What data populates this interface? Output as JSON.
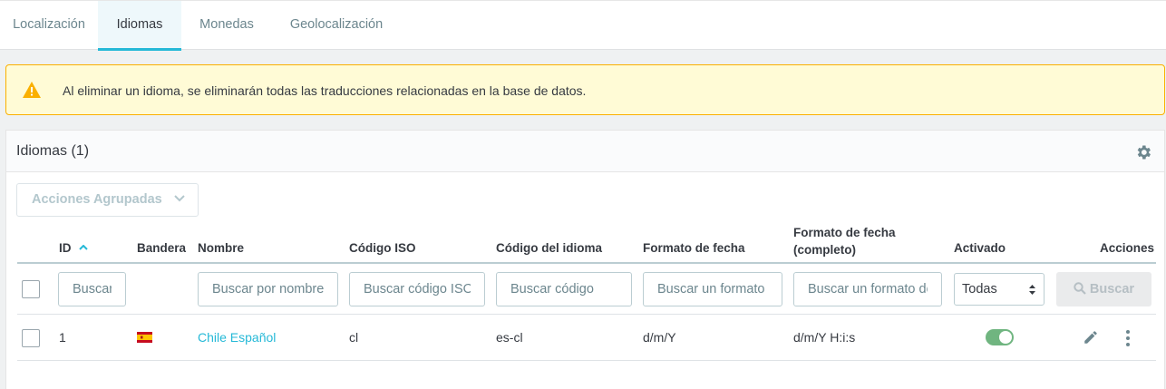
{
  "tabs": [
    {
      "label": "Localización"
    },
    {
      "label": "Idiomas"
    },
    {
      "label": "Monedas"
    },
    {
      "label": "Geolocalización"
    }
  ],
  "alert": {
    "text": "Al eliminar un idioma, se eliminarán todas las traducciones relacionadas en la base de datos."
  },
  "panel": {
    "title": "Idiomas (1)",
    "bulk_actions_label": "Acciones Agrupadas",
    "columns": {
      "id": "ID",
      "flag": "Bandera",
      "name": "Nombre",
      "iso": "Código ISO",
      "lang_code": "Código del idioma",
      "date_format": "Formato de fecha",
      "date_format_full_1": "Formato de fecha",
      "date_format_full_2": "(completo)",
      "active": "Activado",
      "actions": "Acciones"
    },
    "filters": {
      "id_placeholder": "Buscar ID",
      "name_placeholder": "Buscar por nombre",
      "iso_placeholder": "Buscar código ISO",
      "lang_code_placeholder": "Buscar código",
      "date_format_placeholder": "Buscar un formato",
      "date_format_full_placeholder": "Buscar un formato de fecha",
      "active_selected": "Todas",
      "search_button": "Buscar"
    },
    "rows": [
      {
        "id": "1",
        "flag": "es-flag-icon",
        "name": "Chile Español",
        "iso": "cl",
        "lang_code": "es-cl",
        "date_format": "d/m/Y",
        "date_format_full": "d/m/Y H:i:s",
        "active": true
      }
    ]
  },
  "colors": {
    "accent": "#25b9d7",
    "warning": "#fab000",
    "toggle_on": "#70b580"
  }
}
